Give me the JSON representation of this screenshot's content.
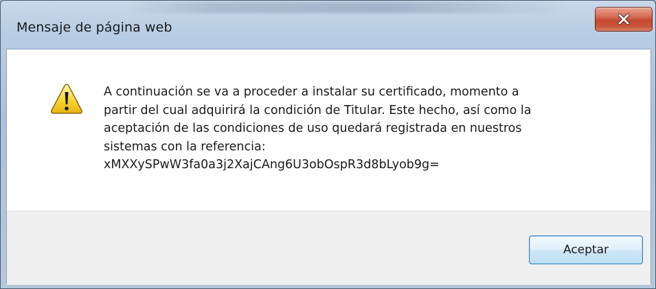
{
  "dialog": {
    "title": "Mensaje de página web",
    "close_icon": "close-icon",
    "warning_icon": "warning-icon",
    "message_lines": [
      "A continuación se va a proceder a instalar su certificado, momento a",
      "partir del cual adquirirá la condición de Titular. Este hecho, así como la",
      "aceptación de las condiciones de uso quedará registrada en nuestros",
      "sistemas con la referencia:",
      "xMXXySPwW3fa0a3j2XajCAng6U3obOspR3d8bLyob9g="
    ],
    "ok_label": "Aceptar"
  },
  "colors": {
    "close_button": "#c44a2f",
    "ok_button_border": "#3c7fb1",
    "footer_background": "#f0f0f0"
  }
}
